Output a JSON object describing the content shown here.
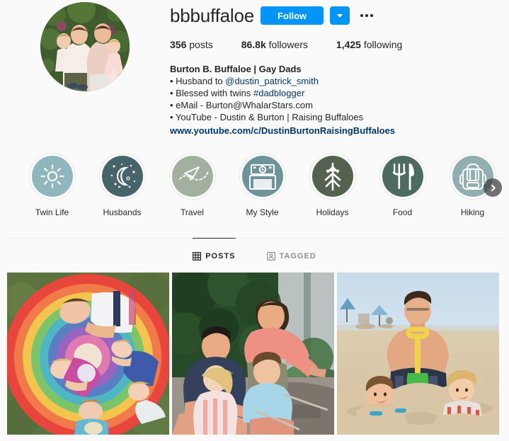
{
  "profile": {
    "username": "bbbuffaloe",
    "avatar_alt": "family-photo-avatar",
    "follow_label": "Follow",
    "stats": [
      {
        "value": "356",
        "label": "posts"
      },
      {
        "value": "86.8k",
        "label": "followers"
      },
      {
        "value": "1,425",
        "label": "following"
      }
    ],
    "bio": {
      "full_name": "Burton B. Buffaloe | Gay Dads",
      "line1_prefix": "• Husband to ",
      "line1_mention": "@dustin_patrick_smith",
      "line2_prefix": "• Blessed with twins ",
      "line2_tag": "#dadblogger",
      "line3": "• eMail - Burton@WhalarStars.com",
      "line4": "• YouTube - Dustin & Burton | Raising Buffaloes",
      "website": "www.youtube.com/c/DustinBurtonRaisingBuffaloes"
    }
  },
  "highlights": [
    {
      "label": "Twin Life",
      "icon": "sun-icon",
      "color": "#8fb5bd"
    },
    {
      "label": "Husbands",
      "icon": "moon-stars-icon",
      "color": "#47646b"
    },
    {
      "label": "Travel",
      "icon": "paper-plane-icon",
      "color": "#a3b0a0"
    },
    {
      "label": "My Style",
      "icon": "camera-icon",
      "color": "#6e939a"
    },
    {
      "label": "Holidays",
      "icon": "pine-tree-icon",
      "color": "#55624f"
    },
    {
      "label": "Food",
      "icon": "fork-knife-icon",
      "color": "#4e6b63"
    },
    {
      "label": "Hiking",
      "icon": "backpack-icon",
      "color": "#91aeb0"
    }
  ],
  "tabs": [
    {
      "label": "POSTS",
      "icon": "grid-icon",
      "active": true
    },
    {
      "label": "TAGGED",
      "icon": "tagged-person-icon",
      "active": false
    }
  ],
  "posts": [
    {
      "alt": "family-on-rainbow-blanket-in-grass"
    },
    {
      "alt": "family-roasting-marshmallows-in-garden"
    },
    {
      "alt": "dad-and-kids-buried-in-beach-sand"
    }
  ],
  "colors": {
    "accent_blue": "#0095f6",
    "link_blue": "#00376b",
    "background": "#fafafa",
    "text": "#262626",
    "muted": "#8e8e8e"
  }
}
